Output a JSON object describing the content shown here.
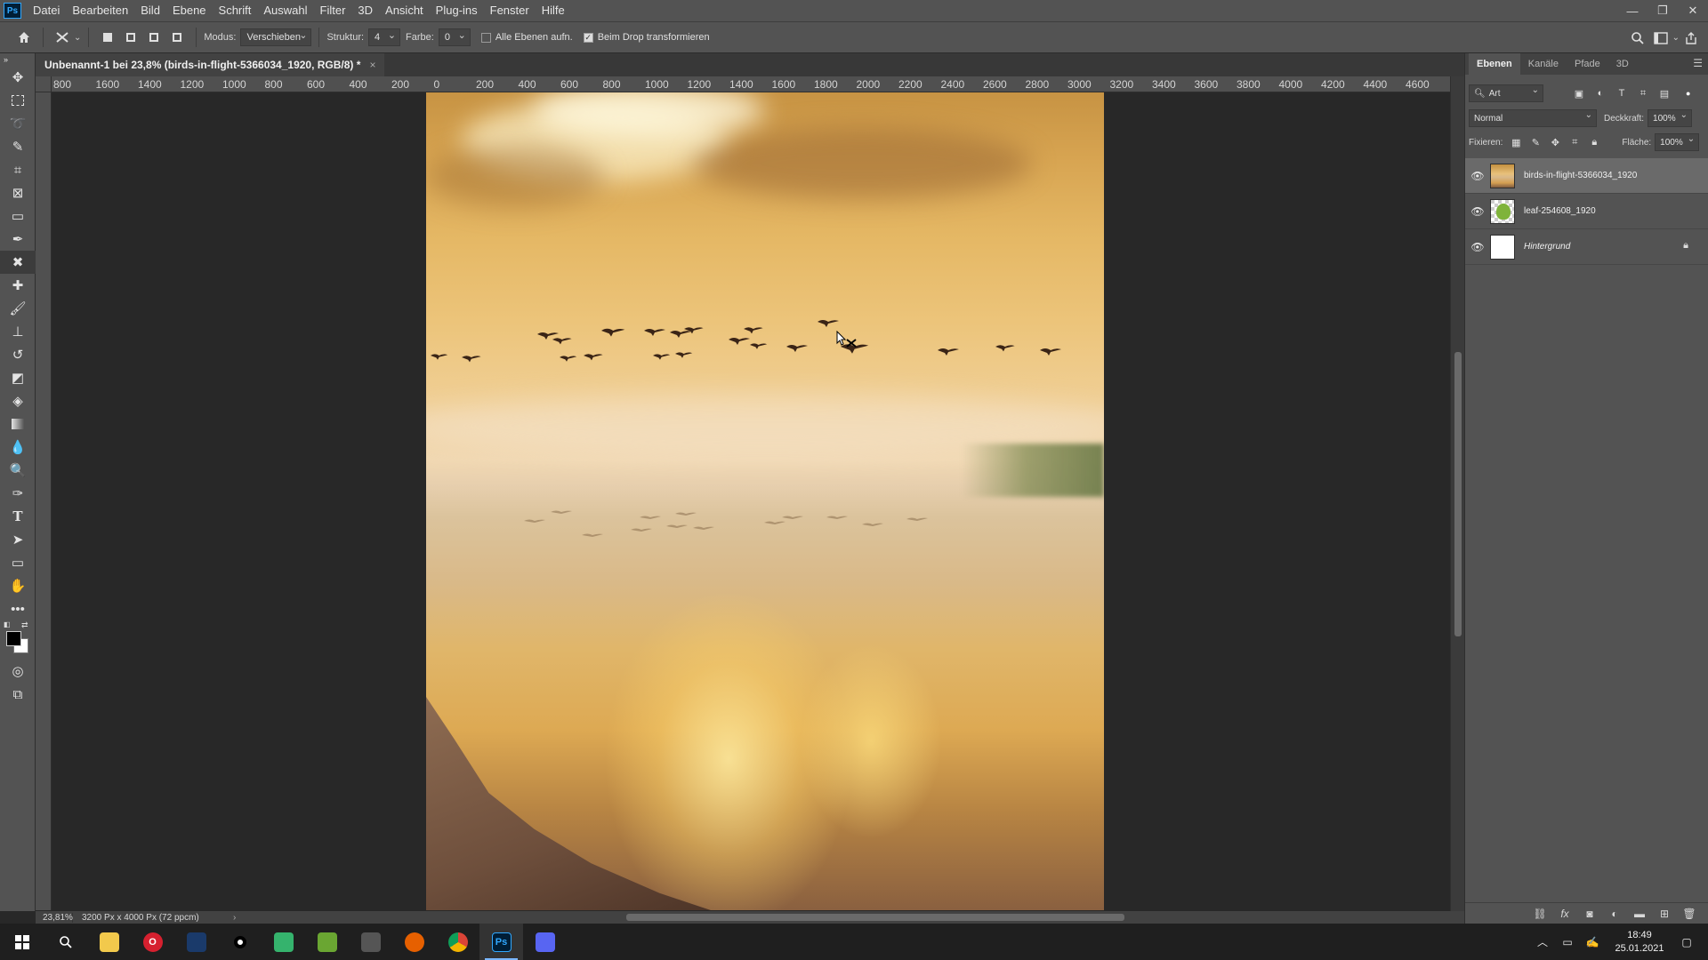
{
  "app": {
    "logo": "Ps"
  },
  "menu": [
    "Datei",
    "Bearbeiten",
    "Bild",
    "Ebene",
    "Schrift",
    "Auswahl",
    "Filter",
    "3D",
    "Ansicht",
    "Plug-ins",
    "Fenster",
    "Hilfe"
  ],
  "window_controls": {
    "minimize": "—",
    "restore": "❐",
    "close": "✕"
  },
  "options": {
    "modus_label": "Modus:",
    "modus_value": "Verschieben",
    "struktur_label": "Struktur:",
    "struktur_value": "4",
    "farbe_label": "Farbe:",
    "farbe_value": "0",
    "alle_ebenen": "Alle Ebenen aufn.",
    "alle_ebenen_checked": false,
    "beim_drop": "Beim Drop transformieren",
    "beim_drop_checked": true
  },
  "document": {
    "tab_title": "Unbenannt-1 bei 23,8% (birds-in-flight-5366034_1920, RGB/8) *",
    "close": "×"
  },
  "ruler_labels": [
    "800",
    "1600",
    "1400",
    "1200",
    "1000",
    "800",
    "600",
    "400",
    "200",
    "0",
    "200",
    "400",
    "600",
    "800",
    "1000",
    "1200",
    "1400",
    "1600",
    "1800",
    "2000",
    "2200",
    "2400",
    "2600",
    "2800",
    "3000",
    "3200",
    "3400",
    "3600",
    "3800",
    "4000",
    "4200",
    "4400",
    "4600"
  ],
  "status": {
    "zoom": "23,81%",
    "info": "3200 Px x 4000 Px (72 ppcm)",
    "arrow": "›"
  },
  "panel": {
    "tabs": [
      "Ebenen",
      "Kanäle",
      "Pfade",
      "3D"
    ],
    "active_tab": "Ebenen",
    "filter_value": "Art",
    "blend_mode": "Normal",
    "opacity_label": "Deckkraft:",
    "opacity_value": "100%",
    "lock_label": "Fixieren:",
    "fill_label": "Fläche:",
    "fill_value": "100%",
    "layers": [
      {
        "name": "birds-in-flight-5366034_1920",
        "selected": true,
        "thumb": "#c99d5e",
        "italic": false,
        "locked": false
      },
      {
        "name": "leaf-254608_1920",
        "selected": false,
        "thumb": "#8fb94a",
        "italic": false,
        "locked": false
      },
      {
        "name": "Hintergrund",
        "selected": false,
        "thumb": "#ffffff",
        "italic": true,
        "locked": true
      }
    ]
  },
  "taskbar": {
    "time": "18:49",
    "date": "25.01.2021",
    "apps": [
      "windows-start",
      "search",
      "file-explorer",
      "opera",
      "app-blue",
      "app-dark",
      "app-green-chat",
      "app-green-layers",
      "app-mask",
      "firefox",
      "chrome",
      "photoshop",
      "discord"
    ]
  },
  "colors": {
    "accent": "#31a8ff",
    "panel_bg": "#535353",
    "workspace_bg": "#282828"
  }
}
